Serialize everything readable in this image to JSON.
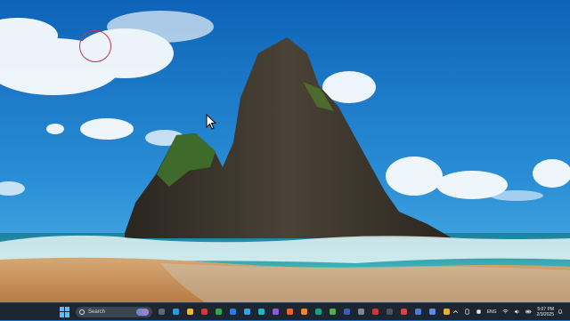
{
  "desktop": {
    "wallpaper": "rock-island-beach",
    "colors": {
      "sky_top": "#0e63b8",
      "sky_bottom": "#3aa1df",
      "sea": "#1a8fa8",
      "sand": "#c9955e"
    }
  },
  "taskbar": {
    "search_placeholder": "Search",
    "pinned_icons": [
      {
        "name": "task-view-icon",
        "color": "#5a6a7e"
      },
      {
        "name": "edge-icon",
        "color": "#2b9be0"
      },
      {
        "name": "file-explorer-icon",
        "color": "#e8b83a"
      },
      {
        "name": "store-app-icon",
        "color": "#d13a3a"
      },
      {
        "name": "app-green-icon",
        "color": "#2ea84f"
      },
      {
        "name": "app-blue-icon",
        "color": "#2b7de0"
      },
      {
        "name": "photos-icon",
        "color": "#3aa1df"
      },
      {
        "name": "app-cyan-icon",
        "color": "#1fb6c9"
      },
      {
        "name": "app-purple-icon",
        "color": "#8e5bd8"
      },
      {
        "name": "firefox-icon",
        "color": "#e8662a"
      },
      {
        "name": "app-orange-icon",
        "color": "#e8892a"
      },
      {
        "name": "app-teal-icon",
        "color": "#16a085"
      },
      {
        "name": "chrome-icon",
        "color": "#4caf50"
      },
      {
        "name": "app-navy-icon",
        "color": "#3a5fb0"
      },
      {
        "name": "app-gray-icon",
        "color": "#7a8898"
      },
      {
        "name": "app-red-icon",
        "color": "#c83a3a"
      },
      {
        "name": "app-dark-icon",
        "color": "#4a5462"
      },
      {
        "name": "app-red2-icon",
        "color": "#d04545"
      },
      {
        "name": "app-blue2-icon",
        "color": "#4a7fd0"
      },
      {
        "name": "app-blue3-icon",
        "color": "#5c8ee0"
      },
      {
        "name": "app-yellow-icon",
        "color": "#e0b33a"
      }
    ],
    "tray": {
      "language": "ENG",
      "time": "5:07 PM",
      "date": "2/3/2025"
    }
  }
}
